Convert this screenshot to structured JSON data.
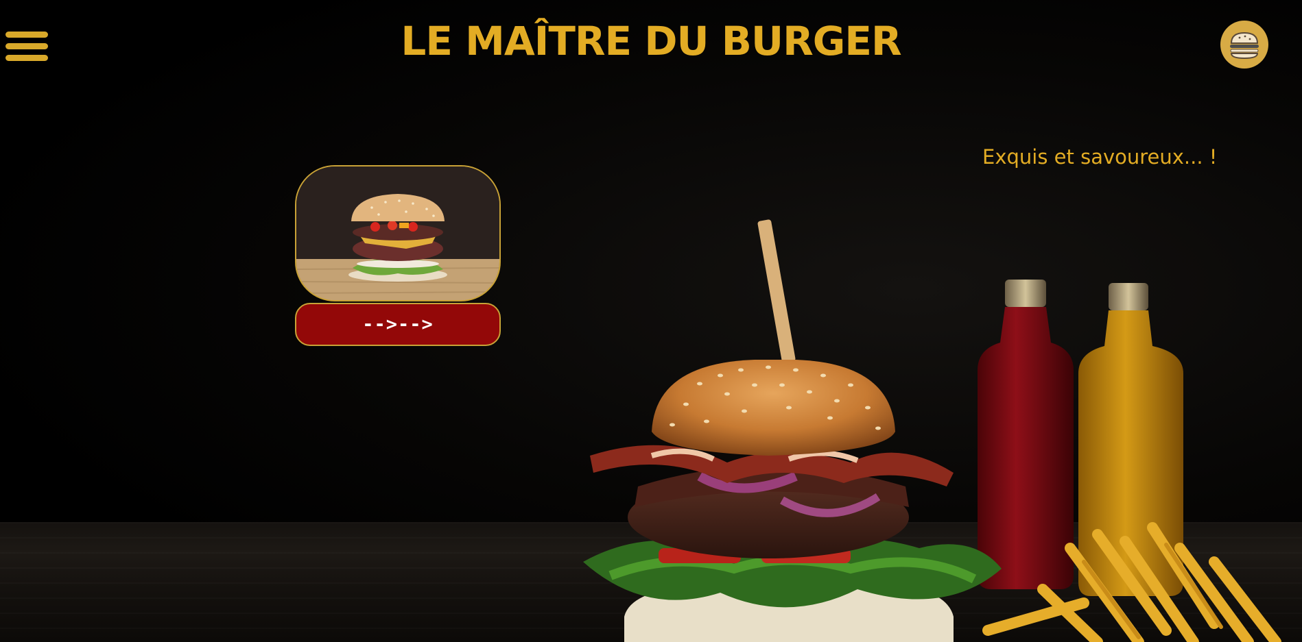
{
  "header": {
    "title": "LE MAÎTRE DU BURGER",
    "menu_icon": "hamburger-menu-icon",
    "logo_icon": "burger-logo-icon"
  },
  "hero": {
    "tagline": "Exquis et savoureux... !"
  },
  "card": {
    "image_icon": "burger-photo",
    "button_label": "-->-->"
  },
  "colors": {
    "accent": "#e3ac24",
    "button_bg": "#930808",
    "background": "#000000"
  }
}
